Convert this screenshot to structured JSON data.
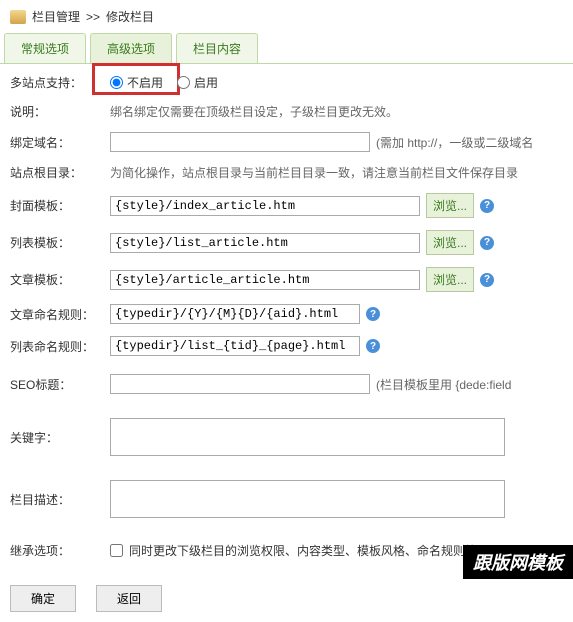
{
  "breadcrumb": {
    "a": "栏目管理",
    "sep": ">>",
    "b": "修改栏目"
  },
  "tabs": {
    "t1": "常规选项",
    "t2": "高级选项",
    "t3": "栏目内容"
  },
  "multisite": {
    "label": "多站点支持：",
    "off": "不启用",
    "on": "启用"
  },
  "desc": {
    "label": "说明：",
    "text": "绑名绑定仅需要在顶级栏目设定，子级栏目更改无效。"
  },
  "domain": {
    "label": "绑定域名：",
    "value": "",
    "hint": "(需加 http://，一级或二级域名"
  },
  "siteroot": {
    "label": "站点根目录：",
    "text": "为简化操作，站点根目录与当前栏目目录一致，请注意当前栏目文件保存目录"
  },
  "cover": {
    "label": "封面模板：",
    "value": "{style}/index_article.htm"
  },
  "list": {
    "label": "列表模板：",
    "value": "{style}/list_article.htm"
  },
  "article": {
    "label": "文章模板：",
    "value": "{style}/article_article.htm"
  },
  "articlerule": {
    "label": "文章命名规则：",
    "value": "{typedir}/{Y}/{M}{D}/{aid}.html"
  },
  "listrule": {
    "label": "列表命名规则：",
    "value": "{typedir}/list_{tid}_{page}.html"
  },
  "seo": {
    "label": "SEO标题：",
    "value": "",
    "hint": "(栏目模板里用 {dede:field"
  },
  "keywords": {
    "label": "关键字：",
    "value": ""
  },
  "colsdesc": {
    "label": "栏目描述：",
    "value": ""
  },
  "inherit": {
    "label": "继承选项：",
    "text": "同时更改下级栏目的浏览权限、内容类型、模板风格、命名规则等通用属"
  },
  "browse": "浏览...",
  "ok": "确定",
  "back": "返回",
  "watermark": "跟版网模板"
}
